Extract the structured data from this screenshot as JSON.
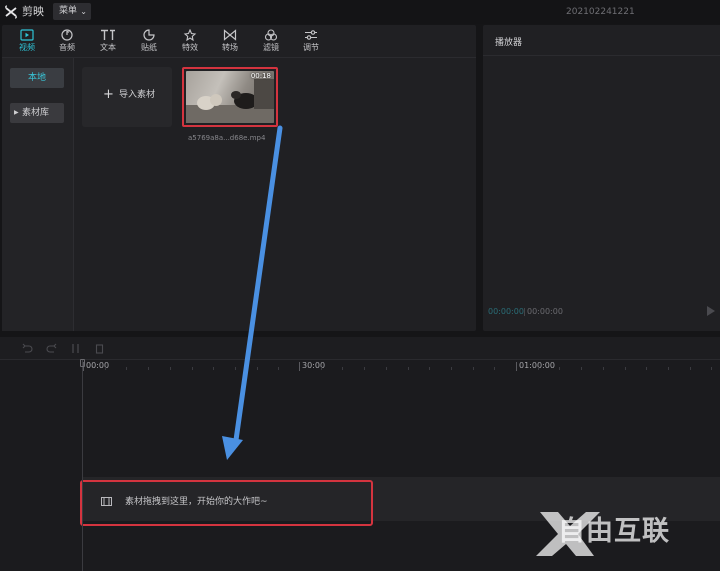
{
  "titlebar": {
    "app_title": "剪映",
    "menu_label": "菜单",
    "project_name": "20210224122​1"
  },
  "tabs": [
    {
      "label": "视频",
      "icon": "video-icon"
    },
    {
      "label": "音频",
      "icon": "audio-icon"
    },
    {
      "label": "文本",
      "icon": "text-icon"
    },
    {
      "label": "贴纸",
      "icon": "sticker-icon"
    },
    {
      "label": "特效",
      "icon": "effects-icon"
    },
    {
      "label": "转场",
      "icon": "transition-icon"
    },
    {
      "label": "滤镜",
      "icon": "filter-icon"
    },
    {
      "label": "调节",
      "icon": "adjust-icon"
    }
  ],
  "sidebar": {
    "local_label": "本地",
    "library_label": "素材库"
  },
  "media": {
    "import_label": "导入素材",
    "clip_duration": "00:18",
    "clip_name": "a5769a8a...d68e.mp4"
  },
  "player": {
    "title": "播放器",
    "time_current": "00:00:00",
    "time_divider": "|",
    "time_total": "00:00:00"
  },
  "timeline": {
    "ticks": [
      "00:00",
      "30:00",
      "01:00:00"
    ],
    "drop_hint": "素材拖拽到这里，开始你的大作吧~"
  },
  "watermark": {
    "text": "自由互联"
  },
  "colors": {
    "accent": "#2fc3d6",
    "highlight": "#d4343f",
    "arrow": "#4a90e2"
  }
}
